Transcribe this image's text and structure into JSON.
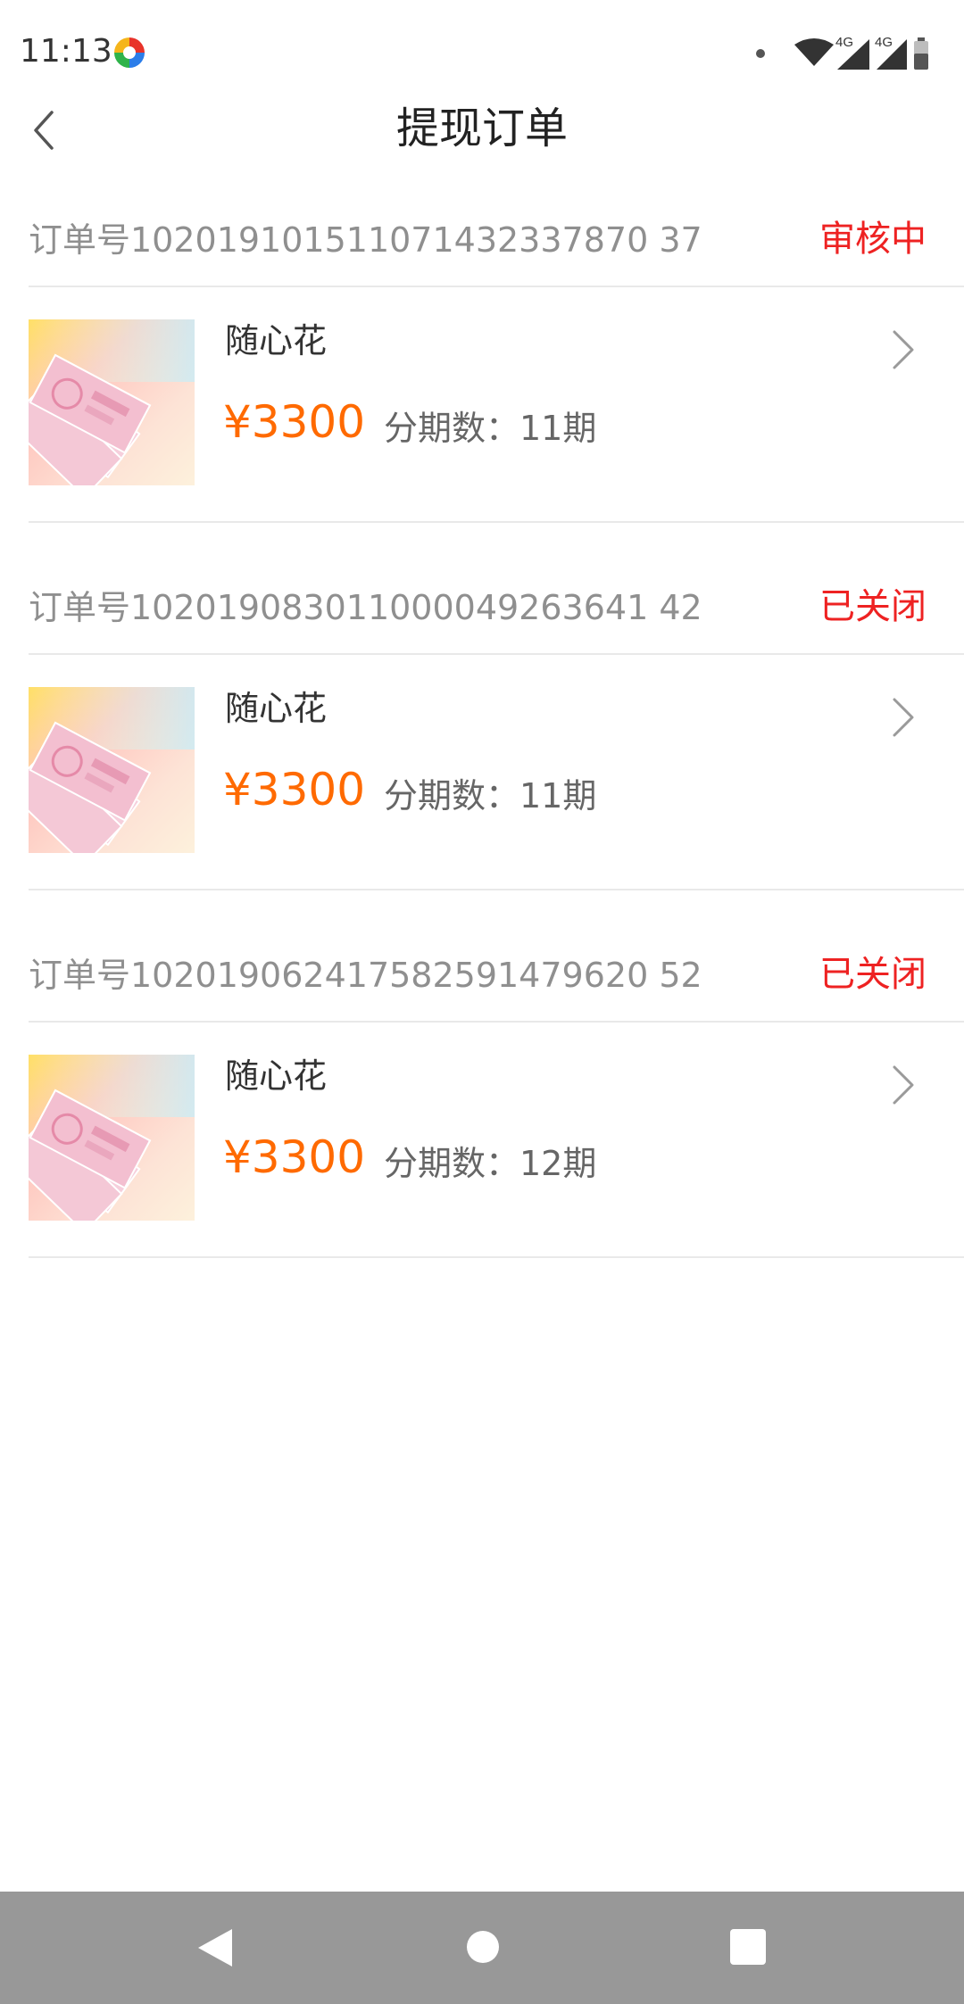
{
  "status_bar": {
    "time": "11:13",
    "network_1": "4G",
    "network_2": "4G"
  },
  "header": {
    "title": "提现订单"
  },
  "orders": [
    {
      "order_number": "订单号102019101511071432337870 37",
      "status": "审核中",
      "product_name": "随心花",
      "price": "¥3300",
      "installments": "分期数：11期"
    },
    {
      "order_number": "订单号102019083011000049263641 42",
      "status": "已关闭",
      "product_name": "随心花",
      "price": "¥3300",
      "installments": "分期数：11期"
    },
    {
      "order_number": "订单号102019062417582591479620 52",
      "status": "已关闭",
      "product_name": "随心花",
      "price": "¥3300",
      "installments": "分期数：12期"
    }
  ],
  "colors": {
    "status": "#ee2222",
    "price": "#ff6a00",
    "nav_bar": "#989898"
  },
  "icons": {
    "back": "back-arrow-icon",
    "chevron": "chevron-right-icon",
    "wifi": "wifi-icon",
    "signal": "signal-icon",
    "battery": "battery-icon"
  }
}
